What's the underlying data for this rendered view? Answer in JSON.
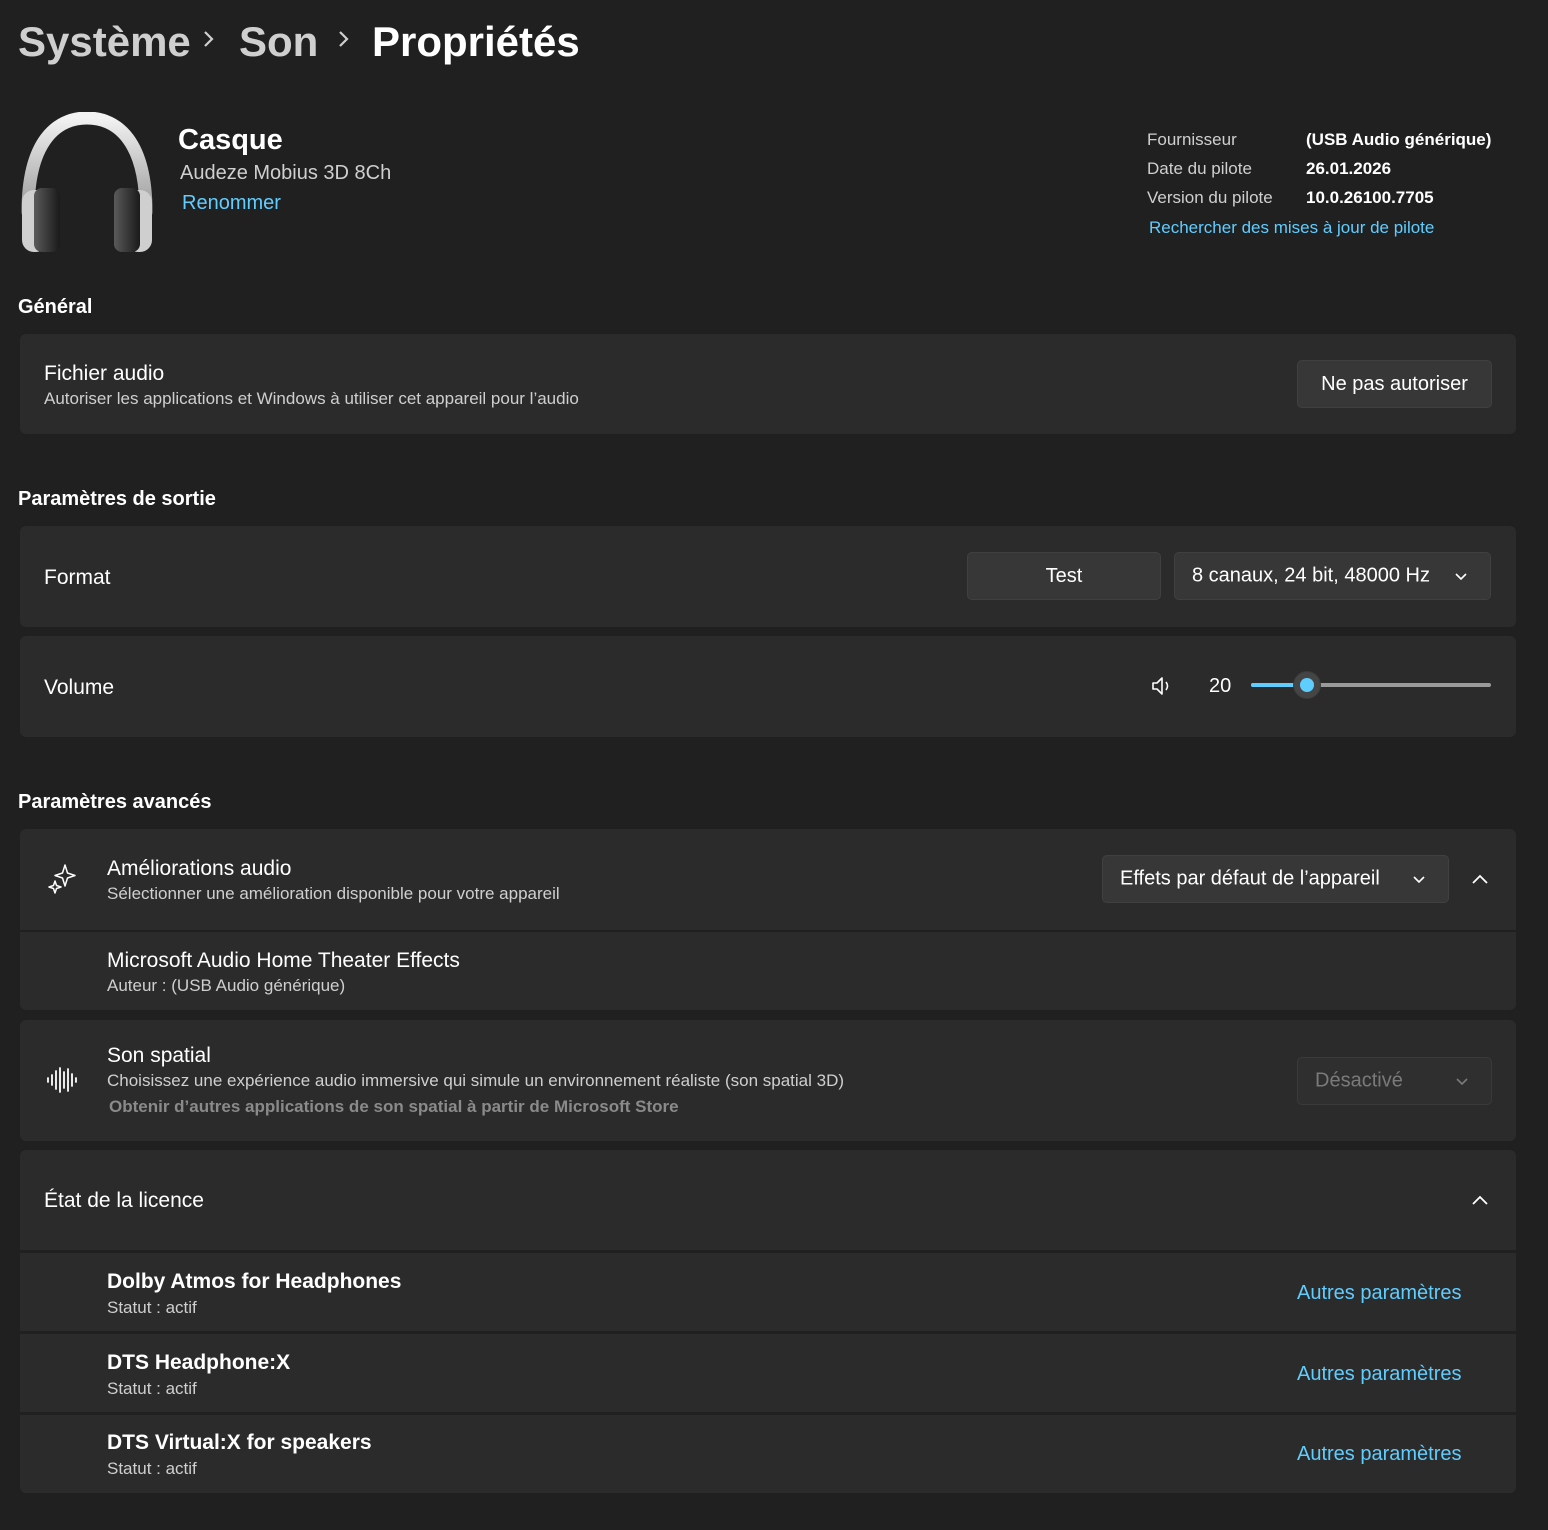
{
  "breadcrumb": {
    "items": [
      "Système",
      "Son",
      "Propriétés"
    ]
  },
  "device": {
    "name": "Casque",
    "model": "Audeze Mobius 3D 8Ch",
    "rename_label": "Renommer",
    "icon": "headphones-icon"
  },
  "driver": {
    "provider_label": "Fournisseur",
    "provider_value": "(USB Audio générique)",
    "date_label": "Date du pilote",
    "date_value": "26.01.2026",
    "version_label": "Version du pilote",
    "version_value": "10.0.26100.7705",
    "update_link": "Rechercher des mises à jour de pilote"
  },
  "general": {
    "heading": "Général",
    "audio_title": "Fichier audio",
    "audio_desc": "Autoriser les applications et Windows à utiliser cet appareil pour l’audio",
    "audio_button": "Ne pas autoriser"
  },
  "output": {
    "heading": "Paramètres de sortie",
    "format_label": "Format",
    "test_button": "Test",
    "format_value": "8 canaux, 24 bit, 48000 Hz",
    "volume_label": "Volume",
    "volume_value": "20",
    "volume_level": 20
  },
  "advanced": {
    "heading": "Paramètres avancés",
    "enh_title": "Améliorations audio",
    "enh_desc": "Sélectionner une amélioration disponible pour votre appareil",
    "enh_value": "Effets par défaut de l’appareil",
    "enh_item_title": "Microsoft Audio Home Theater Effects",
    "enh_item_author": "Auteur : (USB Audio générique)",
    "spatial_title": "Son spatial",
    "spatial_desc": "Choisissez une expérience audio immersive qui simule un environnement réaliste (son spatial 3D)",
    "spatial_store": "Obtenir d’autres applications de son spatial à partir de Microsoft Store",
    "spatial_value": "Désactivé"
  },
  "license": {
    "title": "État de la licence",
    "items": [
      {
        "name": "Dolby Atmos for Headphones",
        "status": "Statut : actif",
        "link": "Autres paramètres"
      },
      {
        "name": "DTS Headphone:X",
        "status": "Statut : actif",
        "link": "Autres paramètres"
      },
      {
        "name": "DTS Virtual:X for speakers",
        "status": "Statut : actif",
        "link": "Autres paramètres"
      }
    ]
  },
  "colors": {
    "accent": "#60cdff",
    "background": "#202020",
    "card": "#2b2b2b"
  }
}
